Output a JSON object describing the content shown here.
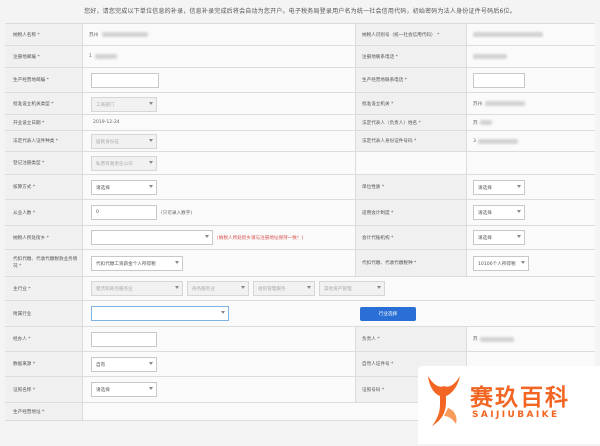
{
  "notice": "您好，请您完成以下单位信息的补录，信息补录完成后将会自动为您开户。电子税务局登录用户名为统一社会信用代码，初始密码为法人身份证件号码后6位。",
  "rows": [
    {
      "l1": "纳税人名称 *",
      "v1": "苏州",
      "l2": "纳税人识别号（统一社会信用代码） *",
      "v2": ""
    },
    {
      "l1": "注册地邮编 *",
      "v1": "1",
      "l2": "注册地联系电话 *",
      "v2": ""
    },
    {
      "l1": "生产经营地邮编 *",
      "v1": "",
      "l2": "生产经营地联系电话 *",
      "v2": ""
    },
    {
      "l1": "批准设立机关类型 *",
      "v1": "工商部门",
      "l2": "批准设立机关 *",
      "v2": "苏州"
    },
    {
      "l1": "开业设立日期 *",
      "v1": "2019-12-24",
      "l2": "法定代表人（负责人）姓名 *",
      "v2": "苏"
    },
    {
      "l1": "法定代表人证件种类 *",
      "v1": "居民身份证",
      "l2": "法定代表人身份证件号码 *",
      "v2": "3"
    },
    {
      "l1": "登记注册类型 *",
      "v1": "私营有限责任公司",
      "l2": "",
      "v2": ""
    },
    {
      "l1": "核算方式 *",
      "v1": "请选择",
      "l2": "单位性质 *",
      "v2": "请选择"
    },
    {
      "l1": "从业人数 *",
      "v1": "0",
      "hint1": "(只可录入数字)",
      "l2": "适用会计制度 *",
      "v2": "请选择"
    },
    {
      "l1": "纳税人所处街乡 *",
      "v1": "",
      "hint1": "(纳税人所处街乡请与注册地址保持一致！)",
      "l2": "会计代账机构 *",
      "v2": "请选择"
    },
    {
      "l1": "代扣代缴、代收代缴税款业务情况 *",
      "v1": "代扣代缴工资薪金个人所得税",
      "l2": "代扣代缴、代收代缴税种 *",
      "v2": "10106个人所得税"
    },
    {
      "l1": "主行业 *",
      "v1": "租赁和商务服务业",
      "v1b": "商务服务业",
      "v1c": "组织管理服务",
      "v1d": "其他资产管理",
      "l2": "",
      "v2": ""
    },
    {
      "l1": "附属行业",
      "v1": "",
      "btn": "行业选择",
      "l2": "",
      "v2": ""
    },
    {
      "l1": "经办人 *",
      "v1": "",
      "l2": "负责人 *",
      "v2": "苏"
    },
    {
      "l1": "数据来源 *",
      "v1": "自有",
      "l2": "自然人证件号 *",
      "v2": ""
    },
    {
      "l1": "证照名称 *",
      "v1": "请选择",
      "l2": "证照号码 *",
      "v2": ""
    },
    {
      "l1": "生产经营地址 *",
      "v1": "",
      "l2": "",
      "v2": ""
    }
  ],
  "logo": {
    "cn": "赛玖百科",
    "en": "SAIJIUBAIKE"
  },
  "colors": {
    "accent_blue": "#2a6fd6",
    "warning_red": "#d9534f",
    "logo_orange": "#f26522"
  }
}
